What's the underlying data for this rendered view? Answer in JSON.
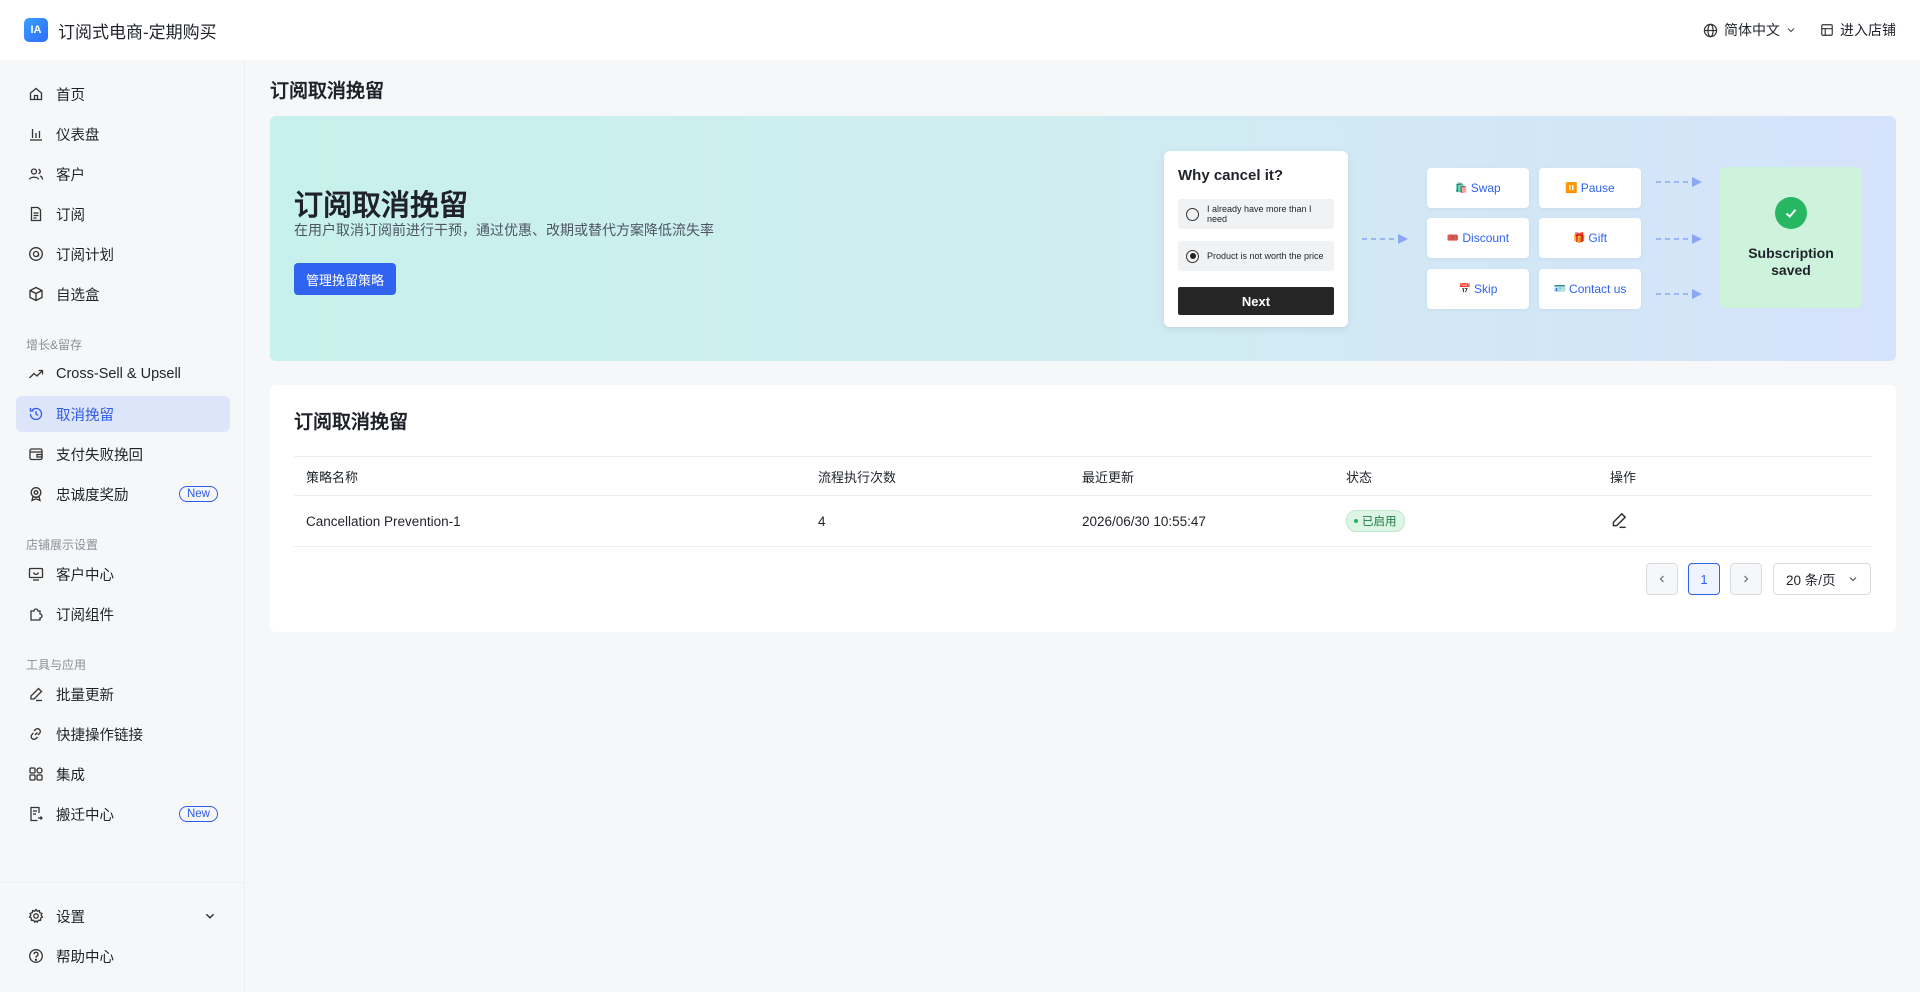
{
  "header": {
    "logo_text": "IA",
    "app_title": "订阅式电商-定期购买",
    "language": "简体中文",
    "enter_store": "进入店铺"
  },
  "sidebar": {
    "items": [
      {
        "label": "首页",
        "icon": "home-icon"
      },
      {
        "label": "仪表盘",
        "icon": "bar-chart-icon"
      },
      {
        "label": "客户",
        "icon": "users-icon"
      },
      {
        "label": "订阅",
        "icon": "document-icon"
      },
      {
        "label": "订阅计划",
        "icon": "plan-icon"
      },
      {
        "label": "自选盒",
        "icon": "box-icon"
      }
    ],
    "section_growth": "增长&留存",
    "growth_items": [
      {
        "label": "Cross-Sell & Upsell",
        "icon": "trend-up-icon"
      },
      {
        "label": "取消挽留",
        "icon": "refresh-icon",
        "active": true
      },
      {
        "label": "支付失败挽回",
        "icon": "wallet-icon"
      },
      {
        "label": "忠诚度奖励",
        "icon": "award-icon",
        "badge": "New"
      }
    ],
    "section_store": "店铺展示设置",
    "store_items": [
      {
        "label": "客户中心",
        "icon": "monitor-icon"
      },
      {
        "label": "订阅组件",
        "icon": "puzzle-icon"
      }
    ],
    "section_tools": "工具与应用",
    "tool_items": [
      {
        "label": "批量更新",
        "icon": "edit-icon"
      },
      {
        "label": "快捷操作链接",
        "icon": "link-icon"
      },
      {
        "label": "集成",
        "icon": "apps-icon"
      },
      {
        "label": "搬迁中心",
        "icon": "migrate-icon",
        "badge": "New"
      }
    ],
    "settings": "设置",
    "help": "帮助中心"
  },
  "page": {
    "title": "订阅取消挽留"
  },
  "hero": {
    "title": "订阅取消挽留",
    "subtitle": "在用户取消订阅前进行干预，通过优惠、改期或替代方案降低流失率",
    "button": "管理挽留策略",
    "survey": {
      "question": "Why cancel it?",
      "option1": "I already have more than I need",
      "option2": "Product is not worth the price",
      "next": "Next"
    },
    "options": {
      "swap": "Swap",
      "pause": "Pause",
      "discount": "Discount",
      "gift": "Gift",
      "skip": "Skip",
      "contact": "Contact us"
    },
    "saved": "Subscription saved"
  },
  "panel": {
    "title": "订阅取消挽留",
    "columns": [
      "策略名称",
      "流程执行次数",
      "最近更新",
      "状态",
      "操作"
    ],
    "rows": [
      {
        "name": "Cancellation Prevention-1",
        "runs": "4",
        "updated": "2026/06/30 10:55:47",
        "status": "已启用"
      }
    ],
    "pagination": {
      "current_page": "1",
      "page_size": "20 条/页"
    }
  },
  "colors": {
    "accent": "#2f63f0",
    "active_bg": "#dde5fb",
    "success": "#27b763"
  }
}
